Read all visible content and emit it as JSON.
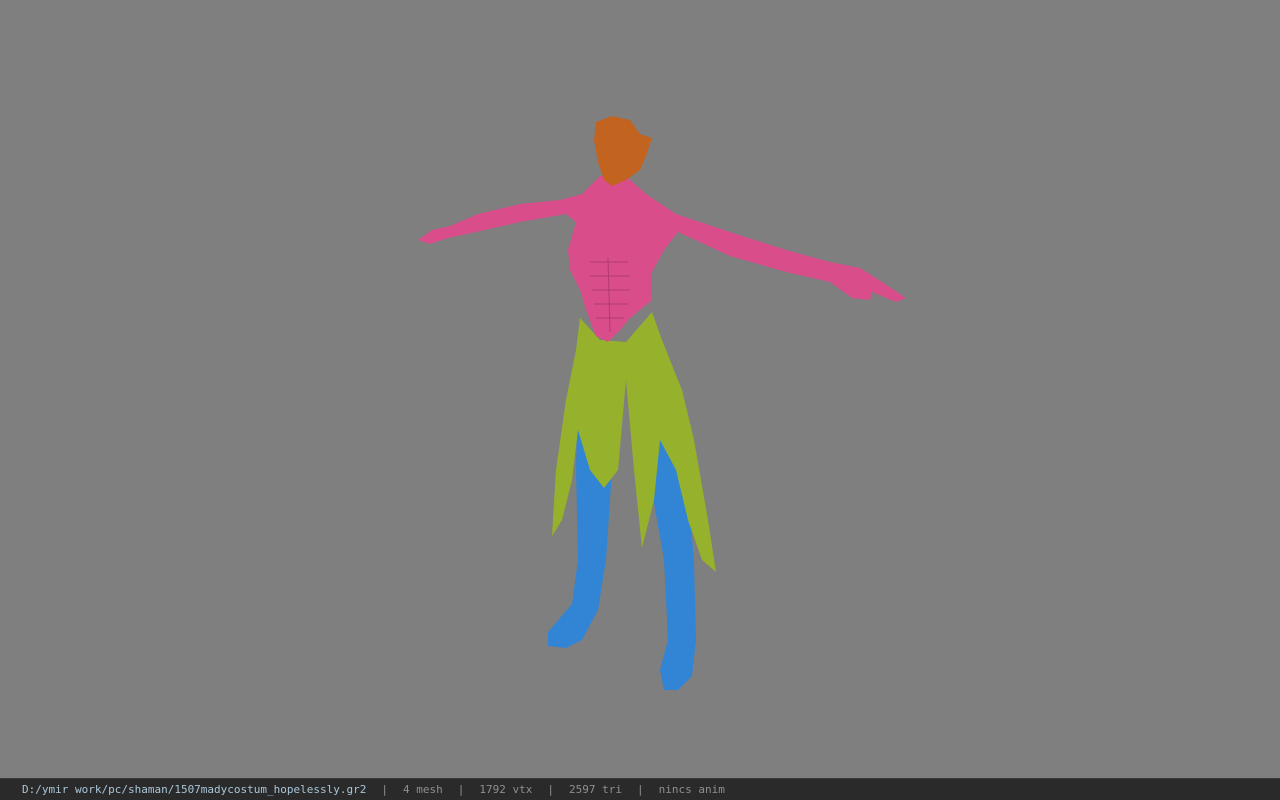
{
  "viewport": {
    "background": "#7f7f7f",
    "model": {
      "skin_color": "#c2631f",
      "top_color": "#d94d8a",
      "skirt_color": "#96b22c",
      "leg_color": "#3284d4"
    }
  },
  "status": {
    "file_path": "D:/ymir work/pc/shaman/1507madycostum_hopelessly.gr2",
    "separator": "|",
    "mesh": "4 mesh",
    "vtx": "1792 vtx",
    "tri": "2597 tri",
    "anim": "nincs anim"
  }
}
